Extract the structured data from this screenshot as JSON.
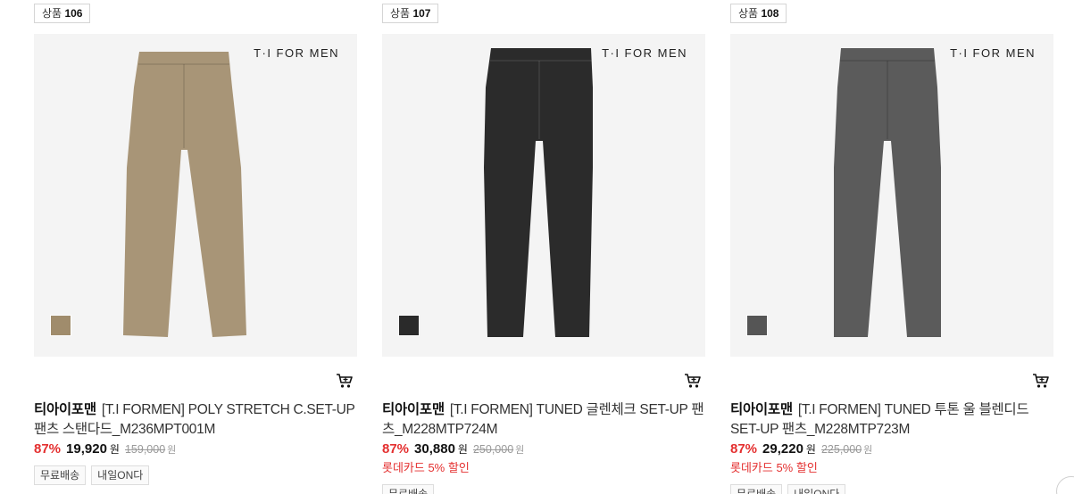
{
  "products": [
    {
      "badge_label": "상품",
      "badge_num": "106",
      "brand_mark": "T·I FOR MEN",
      "brand": "티아이포맨",
      "name": "[T.I FORMEN] POLY STRETCH C.SET-UP 팬츠 스탠다드_M236MPT001M",
      "rate": "87%",
      "price": "19,920",
      "unit": "원",
      "original": "159,000",
      "original_unit": "원",
      "promo": "",
      "tags": [
        "무료배송",
        "내일ON다"
      ],
      "pants_color": "#a89577",
      "swatch_color": "#a08c6c"
    },
    {
      "badge_label": "상품",
      "badge_num": "107",
      "brand_mark": "T·I FOR MEN",
      "brand": "티아이포맨",
      "name": "[T.I FORMEN] TUNED 글렌체크 SET-UP 팬츠_M228MTP724M",
      "rate": "87%",
      "price": "30,880",
      "unit": "원",
      "original": "250,000",
      "original_unit": "원",
      "promo": "롯데카드 5% 할인",
      "tags": [
        "무료배송"
      ],
      "pants_color": "#2b2b2b",
      "swatch_color": "#2a2a2a"
    },
    {
      "badge_label": "상품",
      "badge_num": "108",
      "brand_mark": "T·I FOR MEN",
      "brand": "티아이포맨",
      "name": "[T.I FORMEN] TUNED 투톤 울 블렌디드 SET-UP 팬츠_M228MTP723M",
      "rate": "87%",
      "price": "29,220",
      "unit": "원",
      "original": "225,000",
      "original_unit": "원",
      "promo": "롯데카드 5% 할인",
      "tags": [
        "무료배송",
        "내일ON다"
      ],
      "pants_color": "#5b5b5b",
      "swatch_color": "#555555"
    }
  ],
  "colors": {
    "discount": "#e42f2f",
    "text": "#222222"
  },
  "icons": {
    "cart": "cart-icon"
  }
}
